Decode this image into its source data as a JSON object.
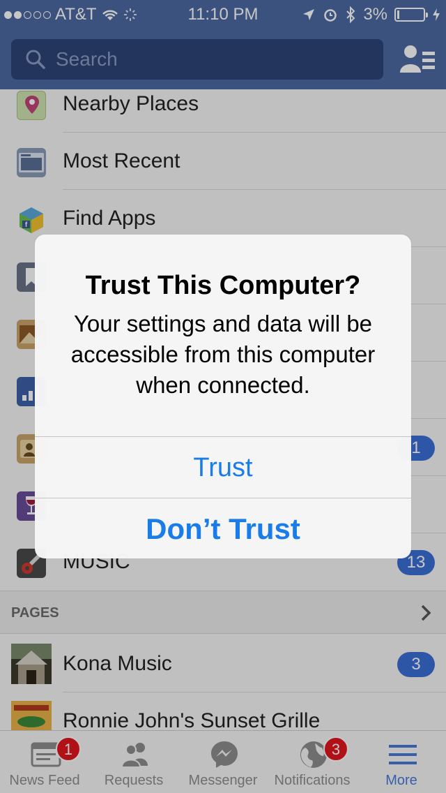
{
  "status_bar": {
    "carrier": "AT&T",
    "time": "11:10 PM",
    "battery": "3%",
    "battery_level": 0.03
  },
  "header": {
    "search_placeholder": "Search",
    "icon": "friends-list-icon"
  },
  "menu": {
    "items": [
      {
        "label": "Nearby Places",
        "icon": "nearby-places-icon"
      },
      {
        "label": "Most Recent",
        "icon": "most-recent-icon"
      },
      {
        "label": "Find Apps",
        "icon": "find-apps-icon"
      },
      {
        "label": "",
        "icon": "saved-icon"
      },
      {
        "label": "",
        "icon": "photos-icon"
      },
      {
        "label": "",
        "icon": "insights-icon"
      },
      {
        "label": "",
        "icon": "contacts-icon",
        "count": "1"
      },
      {
        "label": "",
        "icon": "wine-icon"
      },
      {
        "label": "Music",
        "icon": "music-icon",
        "count": "13"
      }
    ],
    "pages_section_title": "PAGES",
    "pages": [
      {
        "label": "Kona Music",
        "icon": "kona-music-thumb",
        "count": "3"
      },
      {
        "label": "Ronnie John's Sunset Grille",
        "icon": "ronnie-johns-thumb"
      }
    ]
  },
  "alert": {
    "title": "Trust This Computer?",
    "message": "Your settings and data will be accessible from this computer when connected.",
    "buttons": {
      "trust": "Trust",
      "dont_trust": "Don’t Trust"
    }
  },
  "tab_bar": {
    "tabs": [
      {
        "label": "News Feed",
        "icon": "news-feed-icon",
        "badge": "1"
      },
      {
        "label": "Requests",
        "icon": "requests-icon"
      },
      {
        "label": "Messenger",
        "icon": "messenger-icon"
      },
      {
        "label": "Notifications",
        "icon": "notifications-icon",
        "badge": "3"
      },
      {
        "label": "More",
        "icon": "more-icon",
        "active": true
      }
    ]
  },
  "colors": {
    "header_blue": "#4e69a2",
    "search_bg": "#2e4577",
    "alert_button_blue": "#1a7ce8",
    "badge_red": "#e0161e",
    "count_blue": "#3b6fd6",
    "active_tab": "#4a78d9"
  }
}
